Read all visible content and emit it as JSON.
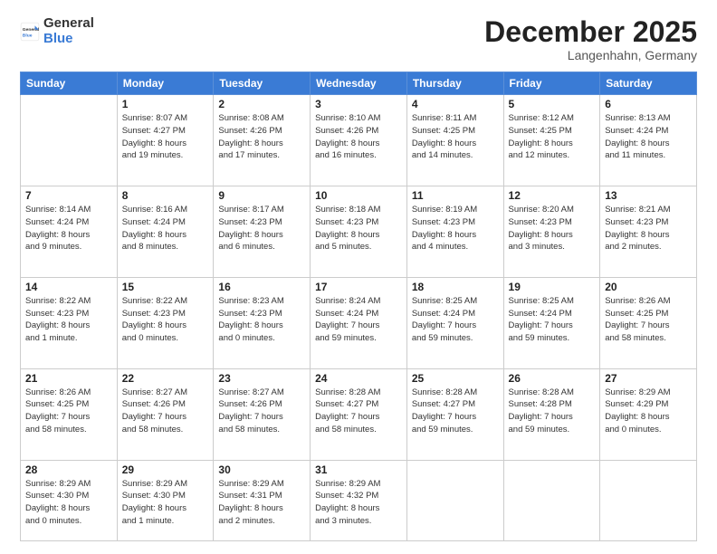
{
  "logo": {
    "general": "General",
    "blue": "Blue"
  },
  "header": {
    "month": "December 2025",
    "location": "Langenhahn, Germany"
  },
  "weekdays": [
    "Sunday",
    "Monday",
    "Tuesday",
    "Wednesday",
    "Thursday",
    "Friday",
    "Saturday"
  ],
  "weeks": [
    [
      {
        "day": "",
        "info": ""
      },
      {
        "day": "1",
        "info": "Sunrise: 8:07 AM\nSunset: 4:27 PM\nDaylight: 8 hours\nand 19 minutes."
      },
      {
        "day": "2",
        "info": "Sunrise: 8:08 AM\nSunset: 4:26 PM\nDaylight: 8 hours\nand 17 minutes."
      },
      {
        "day": "3",
        "info": "Sunrise: 8:10 AM\nSunset: 4:26 PM\nDaylight: 8 hours\nand 16 minutes."
      },
      {
        "day": "4",
        "info": "Sunrise: 8:11 AM\nSunset: 4:25 PM\nDaylight: 8 hours\nand 14 minutes."
      },
      {
        "day": "5",
        "info": "Sunrise: 8:12 AM\nSunset: 4:25 PM\nDaylight: 8 hours\nand 12 minutes."
      },
      {
        "day": "6",
        "info": "Sunrise: 8:13 AM\nSunset: 4:24 PM\nDaylight: 8 hours\nand 11 minutes."
      }
    ],
    [
      {
        "day": "7",
        "info": "Sunrise: 8:14 AM\nSunset: 4:24 PM\nDaylight: 8 hours\nand 9 minutes."
      },
      {
        "day": "8",
        "info": "Sunrise: 8:16 AM\nSunset: 4:24 PM\nDaylight: 8 hours\nand 8 minutes."
      },
      {
        "day": "9",
        "info": "Sunrise: 8:17 AM\nSunset: 4:23 PM\nDaylight: 8 hours\nand 6 minutes."
      },
      {
        "day": "10",
        "info": "Sunrise: 8:18 AM\nSunset: 4:23 PM\nDaylight: 8 hours\nand 5 minutes."
      },
      {
        "day": "11",
        "info": "Sunrise: 8:19 AM\nSunset: 4:23 PM\nDaylight: 8 hours\nand 4 minutes."
      },
      {
        "day": "12",
        "info": "Sunrise: 8:20 AM\nSunset: 4:23 PM\nDaylight: 8 hours\nand 3 minutes."
      },
      {
        "day": "13",
        "info": "Sunrise: 8:21 AM\nSunset: 4:23 PM\nDaylight: 8 hours\nand 2 minutes."
      }
    ],
    [
      {
        "day": "14",
        "info": "Sunrise: 8:22 AM\nSunset: 4:23 PM\nDaylight: 8 hours\nand 1 minute."
      },
      {
        "day": "15",
        "info": "Sunrise: 8:22 AM\nSunset: 4:23 PM\nDaylight: 8 hours\nand 0 minutes."
      },
      {
        "day": "16",
        "info": "Sunrise: 8:23 AM\nSunset: 4:23 PM\nDaylight: 8 hours\nand 0 minutes."
      },
      {
        "day": "17",
        "info": "Sunrise: 8:24 AM\nSunset: 4:24 PM\nDaylight: 7 hours\nand 59 minutes."
      },
      {
        "day": "18",
        "info": "Sunrise: 8:25 AM\nSunset: 4:24 PM\nDaylight: 7 hours\nand 59 minutes."
      },
      {
        "day": "19",
        "info": "Sunrise: 8:25 AM\nSunset: 4:24 PM\nDaylight: 7 hours\nand 59 minutes."
      },
      {
        "day": "20",
        "info": "Sunrise: 8:26 AM\nSunset: 4:25 PM\nDaylight: 7 hours\nand 58 minutes."
      }
    ],
    [
      {
        "day": "21",
        "info": "Sunrise: 8:26 AM\nSunset: 4:25 PM\nDaylight: 7 hours\nand 58 minutes."
      },
      {
        "day": "22",
        "info": "Sunrise: 8:27 AM\nSunset: 4:26 PM\nDaylight: 7 hours\nand 58 minutes."
      },
      {
        "day": "23",
        "info": "Sunrise: 8:27 AM\nSunset: 4:26 PM\nDaylight: 7 hours\nand 58 minutes."
      },
      {
        "day": "24",
        "info": "Sunrise: 8:28 AM\nSunset: 4:27 PM\nDaylight: 7 hours\nand 58 minutes."
      },
      {
        "day": "25",
        "info": "Sunrise: 8:28 AM\nSunset: 4:27 PM\nDaylight: 7 hours\nand 59 minutes."
      },
      {
        "day": "26",
        "info": "Sunrise: 8:28 AM\nSunset: 4:28 PM\nDaylight: 7 hours\nand 59 minutes."
      },
      {
        "day": "27",
        "info": "Sunrise: 8:29 AM\nSunset: 4:29 PM\nDaylight: 8 hours\nand 0 minutes."
      }
    ],
    [
      {
        "day": "28",
        "info": "Sunrise: 8:29 AM\nSunset: 4:30 PM\nDaylight: 8 hours\nand 0 minutes."
      },
      {
        "day": "29",
        "info": "Sunrise: 8:29 AM\nSunset: 4:30 PM\nDaylight: 8 hours\nand 1 minute."
      },
      {
        "day": "30",
        "info": "Sunrise: 8:29 AM\nSunset: 4:31 PM\nDaylight: 8 hours\nand 2 minutes."
      },
      {
        "day": "31",
        "info": "Sunrise: 8:29 AM\nSunset: 4:32 PM\nDaylight: 8 hours\nand 3 minutes."
      },
      {
        "day": "",
        "info": ""
      },
      {
        "day": "",
        "info": ""
      },
      {
        "day": "",
        "info": ""
      }
    ]
  ]
}
